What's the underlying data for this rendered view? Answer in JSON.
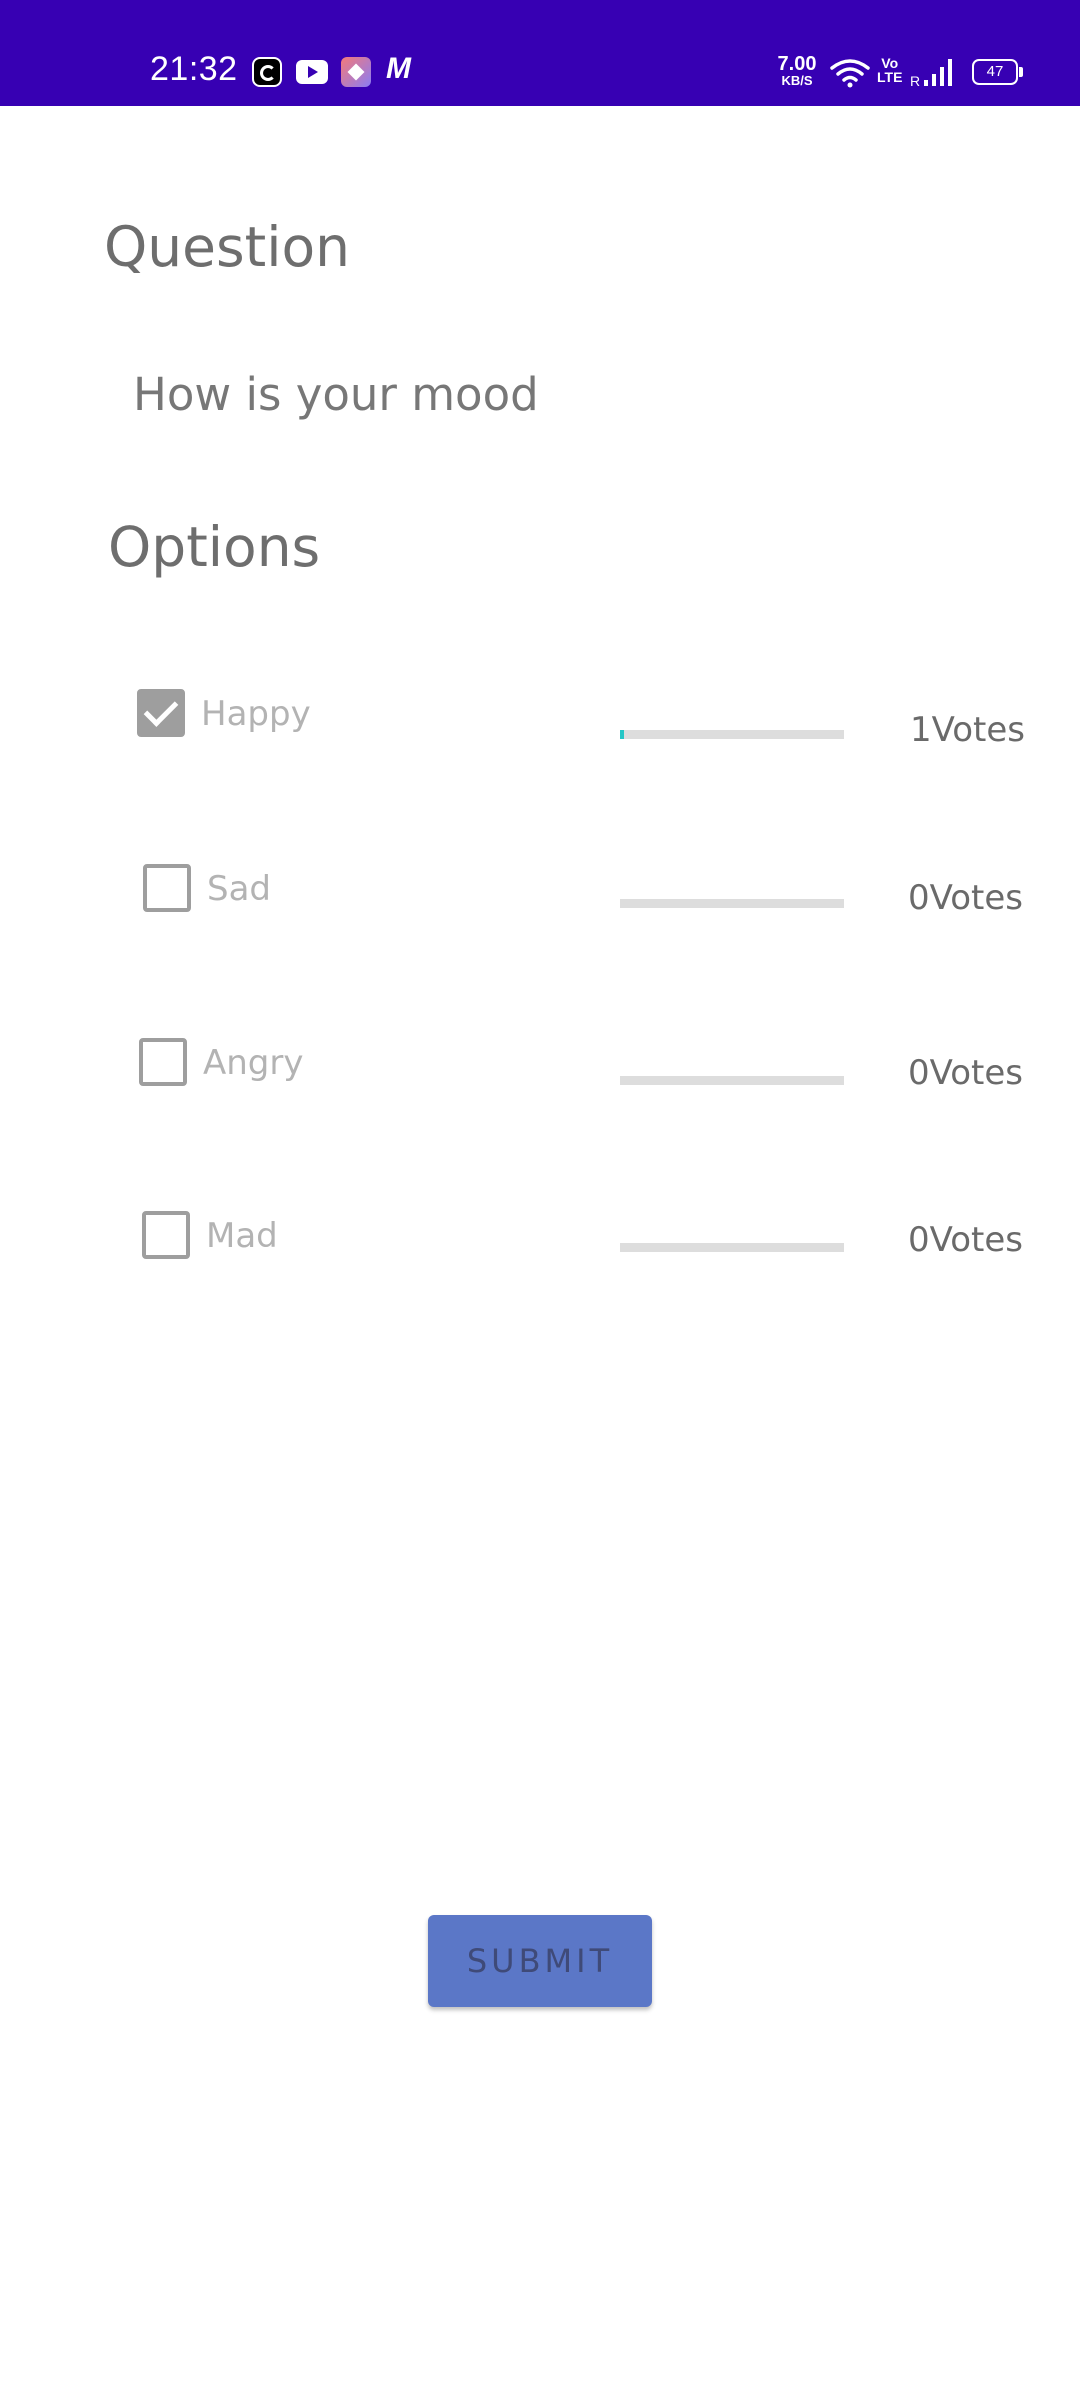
{
  "status_bar": {
    "time": "21:32",
    "net_speed_value": "7.00",
    "net_speed_unit": "KB/S",
    "volte_top": "Vo",
    "volte_bottom": "LTE",
    "roaming": "R",
    "battery": "47",
    "notification_icons": [
      "c-app-icon",
      "youtube-icon",
      "app-icon",
      "m-app-icon"
    ],
    "background_color": "#3700b3"
  },
  "question": {
    "heading": "Question",
    "text": "How is your mood"
  },
  "options": {
    "heading": "Options",
    "items": [
      {
        "label": "Happy",
        "checked": true,
        "progress": 0.01,
        "votes": "1Votes"
      },
      {
        "label": "Sad",
        "checked": false,
        "progress": 0,
        "votes": "0Votes"
      },
      {
        "label": "Angry",
        "checked": false,
        "progress": 0,
        "votes": "0Votes"
      },
      {
        "label": "Mad",
        "checked": false,
        "progress": 0,
        "votes": "0Votes"
      }
    ]
  },
  "submit": {
    "label": "SUBMIT",
    "color": "#5b77c7"
  },
  "colors": {
    "accent": "#26c6c6",
    "text_gray": "#6e6e6e"
  }
}
